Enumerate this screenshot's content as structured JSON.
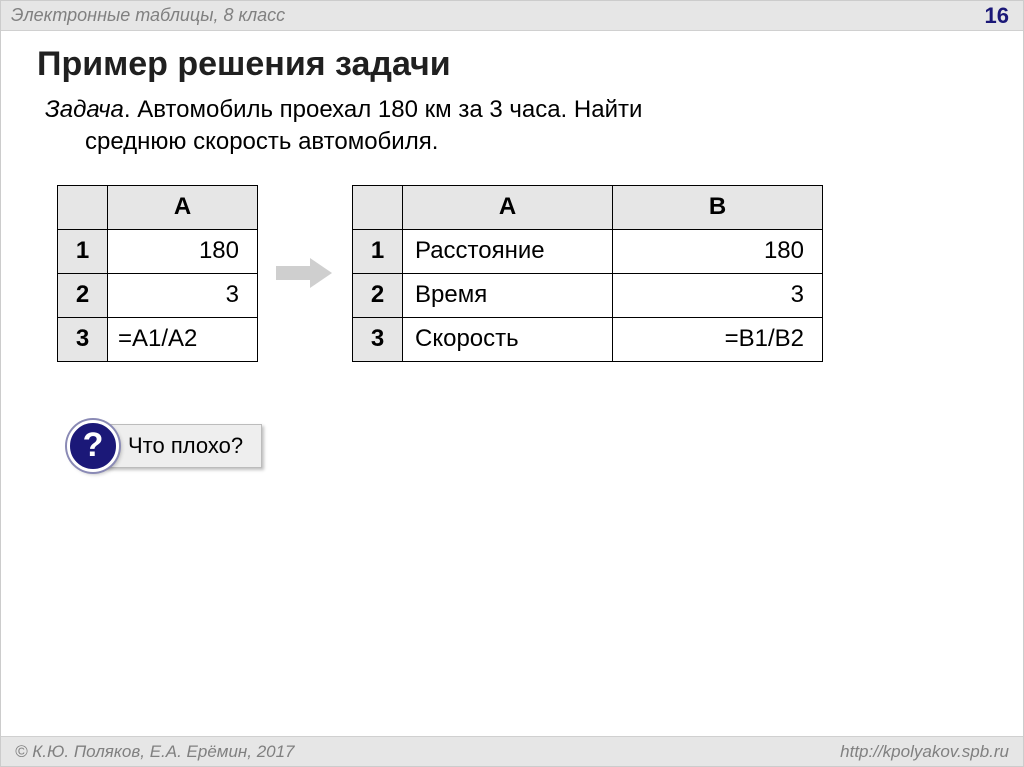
{
  "header": {
    "subject": "Электронные таблицы, 8 класс",
    "page": "16"
  },
  "title": "Пример решения задачи",
  "task": {
    "label": "Задача",
    "text_line1": ". Автомобиль проехал 180 км за 3 часа. Найти",
    "text_line2": "среднюю скорость автомобиля."
  },
  "table1": {
    "col": "A",
    "rows": [
      {
        "n": "1",
        "a": "180",
        "align": "right"
      },
      {
        "n": "2",
        "a": "3",
        "align": "right"
      },
      {
        "n": "3",
        "a": "=A1/A2",
        "align": "left"
      }
    ]
  },
  "table2": {
    "cols": [
      "A",
      "B"
    ],
    "rows": [
      {
        "n": "1",
        "a": "Расстояние",
        "b": "180",
        "b_align": "right"
      },
      {
        "n": "2",
        "a": "Время",
        "b": "3",
        "b_align": "right"
      },
      {
        "n": "3",
        "a": "Скорость",
        "b": "=B1/B2",
        "b_align": "right"
      }
    ]
  },
  "question": {
    "mark": "?",
    "text": "Что плохо?"
  },
  "footer": {
    "left": "© К.Ю. Поляков, Е.А. Ерёмин, 2017",
    "right": "http://kpolyakov.spb.ru"
  }
}
